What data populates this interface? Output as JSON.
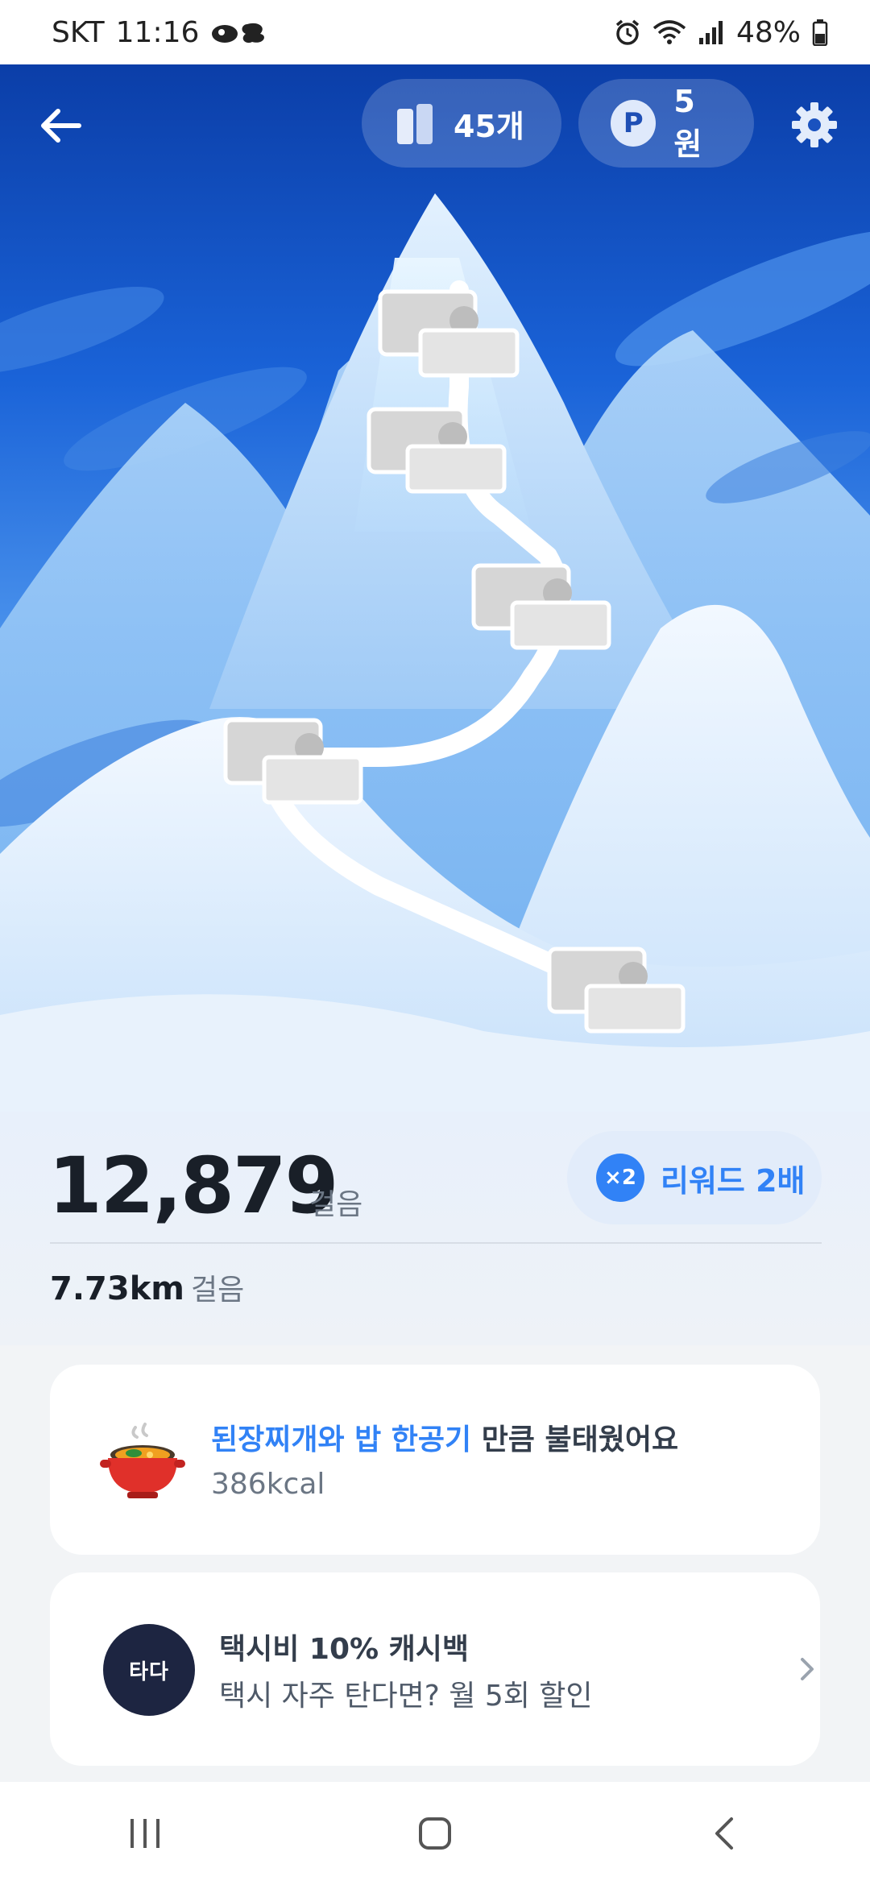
{
  "status_bar": {
    "carrier": "SKT",
    "time": "11:16",
    "battery": "48%"
  },
  "header": {
    "boxes_count": "45개",
    "points_badge": "P",
    "points_value": "5원"
  },
  "summary": {
    "steps": "12,879",
    "steps_unit": "걸음",
    "reward_badge": "×2",
    "reward_label": "리워드 2배",
    "distance": "7.73km",
    "distance_unit": "걸음"
  },
  "calorie_card": {
    "highlight": "된장찌개와 밥 한공기",
    "rest": " 만큼 불태웠어요",
    "value": "386kcal"
  },
  "taxi_card": {
    "logo_text": "타다",
    "title": "택시비 10% 캐시백",
    "subtitle": "택시 자주 탄다면? 월 5회 할인"
  },
  "colors": {
    "accent": "#3182f6",
    "sky_top": "#0b3ea8",
    "taxi_logo_bg": "#1d2541"
  },
  "icons": [
    "arrow-left-icon",
    "gift-box-icon",
    "points-icon",
    "gear-icon",
    "stew-pot-icon",
    "chevron-right-icon",
    "recent-apps-icon",
    "home-icon",
    "nav-back-icon"
  ]
}
